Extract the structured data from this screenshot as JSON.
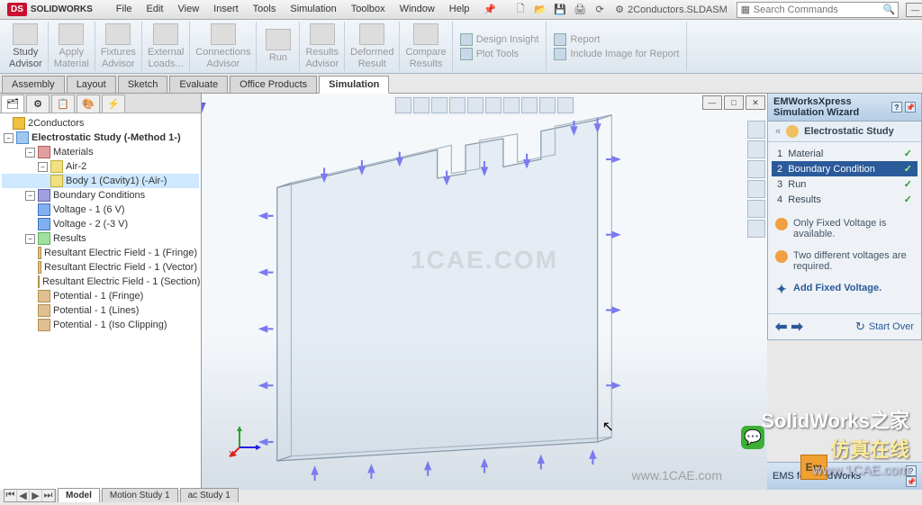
{
  "app": {
    "brand_prefix": "DS",
    "brand_name": "SOLIDWORKS",
    "document": "2Conductors.SLDASM",
    "search_placeholder": "Search Commands"
  },
  "menu": [
    "File",
    "Edit",
    "View",
    "Insert",
    "Tools",
    "Simulation",
    "Toolbox",
    "Window",
    "Help"
  ],
  "ribbon": {
    "items": [
      {
        "label": "Study\nAdvisor",
        "enabled": true
      },
      {
        "label": "Apply\nMaterial",
        "enabled": false
      },
      {
        "label": "Fixtures\nAdvisor",
        "enabled": false
      },
      {
        "label": "External\nLoads...",
        "enabled": false
      },
      {
        "label": "Connections\nAdvisor",
        "enabled": false
      },
      {
        "label": "Run",
        "enabled": false
      },
      {
        "label": "Results\nAdvisor",
        "enabled": false
      },
      {
        "label": "Deformed\nResult",
        "enabled": false
      },
      {
        "label": "Compare\nResults",
        "enabled": false
      }
    ],
    "stack1": [
      {
        "label": "Design Insight",
        "enabled": false
      },
      {
        "label": "Plot Tools",
        "enabled": false
      }
    ],
    "stack2": [
      {
        "label": "Report",
        "enabled": false
      },
      {
        "label": "Include Image for Report",
        "enabled": false
      }
    ]
  },
  "tabs": {
    "items": [
      "Assembly",
      "Layout",
      "Sketch",
      "Evaluate",
      "Office Products",
      "Simulation"
    ],
    "active": 5
  },
  "tree": {
    "root": "2Conductors",
    "study": "Electrostatic Study (-Method 1-)",
    "materials": {
      "label": "Materials",
      "items": [
        "Air-2",
        "Body 1 (Cavity1) (-Air-)"
      ]
    },
    "boundary": {
      "label": "Boundary Conditions",
      "items": [
        "Voltage - 1 (6 V)",
        "Voltage - 2 (-3 V)"
      ]
    },
    "results": {
      "label": "Results",
      "items": [
        "Resultant Electric Field - 1 (Fringe)",
        "Resultant Electric Field - 1 (Vector)",
        "Resultant Electric Field - 1 (Section)",
        "Potential - 1 (Fringe)",
        "Potential - 1 (Lines)",
        "Potential - 1 (Iso Clipping)"
      ]
    }
  },
  "wizard": {
    "title": "EMWorksXpress Simulation Wizard",
    "study_label": "Electrostatic Study",
    "steps": [
      {
        "n": "1",
        "label": "Material",
        "done": true
      },
      {
        "n": "2",
        "label": "Boundary Condition",
        "done": true,
        "active": true
      },
      {
        "n": "3",
        "label": "Run",
        "done": true
      },
      {
        "n": "4",
        "label": "Results",
        "done": true
      }
    ],
    "hints": [
      "Only Fixed Voltage is available.",
      "Two different voltages are required."
    ],
    "action_link": "Add Fixed Voltage.",
    "start_over": "Start Over"
  },
  "ems_panel": "EMS for SolidWorks",
  "bottom_tabs": {
    "items": [
      "Model",
      "Motion Study 1",
      "ac Study 1"
    ],
    "active": 0
  },
  "watermark": "1CAE.COM",
  "footer_url": "www.1CAE.com",
  "overlay": {
    "line1": "SolidWorks之家",
    "line2": "仿真在线",
    "url": "www.1CAE.com"
  },
  "em_badge": "Em"
}
